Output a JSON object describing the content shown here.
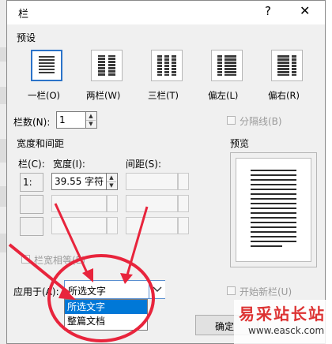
{
  "dialog": {
    "title": "栏",
    "help": "?",
    "close": "✕"
  },
  "presets": {
    "label": "预设",
    "items": [
      {
        "label": "一栏(O)",
        "cols": 1
      },
      {
        "label": "两栏(W)",
        "cols": 2
      },
      {
        "label": "三栏(T)",
        "cols": 3
      },
      {
        "label": "偏左(L)",
        "cols": 2
      },
      {
        "label": "偏右(R)",
        "cols": 2
      }
    ]
  },
  "columns_count": {
    "label": "栏数(N):",
    "value": "1"
  },
  "separator": {
    "label": "分隔线(B)"
  },
  "width_spacing": {
    "label": "宽度和间距",
    "col_header": "栏(C):",
    "width_header": "宽度(I):",
    "spacing_header": "间距(S):",
    "rows": [
      {
        "index": "1:",
        "width": "39.55 字符",
        "spacing": ""
      },
      {
        "index": "",
        "width": "",
        "spacing": ""
      },
      {
        "index": "",
        "width": "",
        "spacing": ""
      }
    ],
    "equal_width_label": "栏宽相等(E)"
  },
  "preview": {
    "label": "预览"
  },
  "apply_to": {
    "label": "应用于(A):",
    "value": "所选文字",
    "options": [
      "所选文字",
      "整篇文档"
    ]
  },
  "start_new_column": {
    "label": "开始新栏(U)"
  },
  "buttons": {
    "ok": "确定"
  },
  "watermark": {
    "text": "易采站长站",
    "url": "www.easck.com"
  },
  "colors": {
    "selection_blue": "#0078d7",
    "annotation_red": "#e8243c"
  }
}
